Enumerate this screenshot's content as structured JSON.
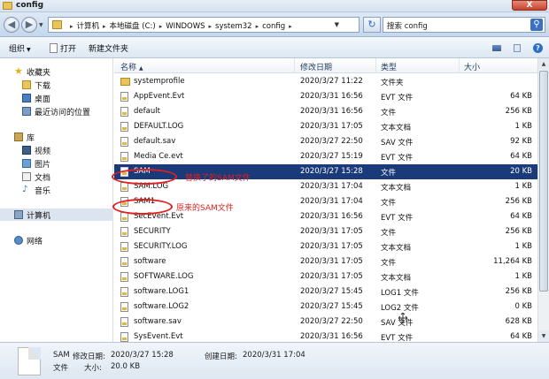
{
  "window": {
    "title": "config",
    "close_label": "X"
  },
  "address": {
    "crumbs": [
      "计算机",
      "本地磁盘 (C:)",
      "WINDOWS",
      "system32",
      "config"
    ],
    "search_placeholder": "搜索 config"
  },
  "toolbar": {
    "organize": "组织",
    "open": "打开",
    "new_folder": "新建文件夹"
  },
  "nav": {
    "favorites": "收藏夹",
    "downloads": "下载",
    "desktop": "桌面",
    "recent": "最近访问的位置",
    "libraries": "库",
    "videos": "视频",
    "pictures": "图片",
    "documents": "文档",
    "music": "音乐",
    "computer": "计算机",
    "network": "网络"
  },
  "columns": {
    "name": "名称",
    "date": "修改日期",
    "type": "类型",
    "size": "大小"
  },
  "files": [
    {
      "name": "systemprofile",
      "date": "2020/3/27 11:22",
      "type": "文件夹",
      "size": "",
      "folder": true
    },
    {
      "name": "AppEvent.Evt",
      "date": "2020/3/31 16:56",
      "type": "EVT 文件",
      "size": "64 KB"
    },
    {
      "name": "default",
      "date": "2020/3/31 16:56",
      "type": "文件",
      "size": "256 KB"
    },
    {
      "name": "DEFAULT.LOG",
      "date": "2020/3/31 17:05",
      "type": "文本文档",
      "size": "1 KB"
    },
    {
      "name": "default.sav",
      "date": "2020/3/27 22:50",
      "type": "SAV 文件",
      "size": "92 KB"
    },
    {
      "name": "Media Ce.evt",
      "date": "2020/3/27 15:19",
      "type": "EVT 文件",
      "size": "64 KB"
    },
    {
      "name": "SAM",
      "date": "2020/3/27 15:28",
      "type": "文件",
      "size": "20 KB",
      "selected": true
    },
    {
      "name": "SAM.LOG",
      "date": "2020/3/31 17:04",
      "type": "文本文档",
      "size": "1 KB"
    },
    {
      "name": "SAM1",
      "date": "2020/3/31 17:04",
      "type": "文件",
      "size": "256 KB"
    },
    {
      "name": "SecEvent.Evt",
      "date": "2020/3/31 16:56",
      "type": "EVT 文件",
      "size": "64 KB"
    },
    {
      "name": "SECURITY",
      "date": "2020/3/31 17:05",
      "type": "文件",
      "size": "256 KB"
    },
    {
      "name": "SECURITY.LOG",
      "date": "2020/3/31 17:05",
      "type": "文本文档",
      "size": "1 KB"
    },
    {
      "name": "software",
      "date": "2020/3/31 17:05",
      "type": "文件",
      "size": "11,264 KB"
    },
    {
      "name": "SOFTWARE.LOG",
      "date": "2020/3/31 17:05",
      "type": "文本文档",
      "size": "1 KB"
    },
    {
      "name": "software.LOG1",
      "date": "2020/3/27 15:45",
      "type": "LOG1 文件",
      "size": "256 KB"
    },
    {
      "name": "software.LOG2",
      "date": "2020/3/27 15:45",
      "type": "LOG2 文件",
      "size": "0 KB"
    },
    {
      "name": "software.sav",
      "date": "2020/3/27 22:50",
      "type": "SAV 文件",
      "size": "628 KB"
    },
    {
      "name": "SysEvent.Evt",
      "date": "2020/3/31 16:56",
      "type": "EVT 文件",
      "size": "64 KB"
    }
  ],
  "annotations": {
    "replaced": "替换了的SAM文件",
    "original": "原来的SAM文件"
  },
  "details": {
    "name": "SAM",
    "modified_label": "修改日期:",
    "modified": "2020/3/27 15:28",
    "created_label": "创建日期:",
    "created": "2020/3/31 17:04",
    "type": "文件",
    "size_label": "大小:",
    "size": "20.0 KB"
  },
  "colors": {
    "selection": "#1a3a7a",
    "annotation": "#e02020"
  }
}
